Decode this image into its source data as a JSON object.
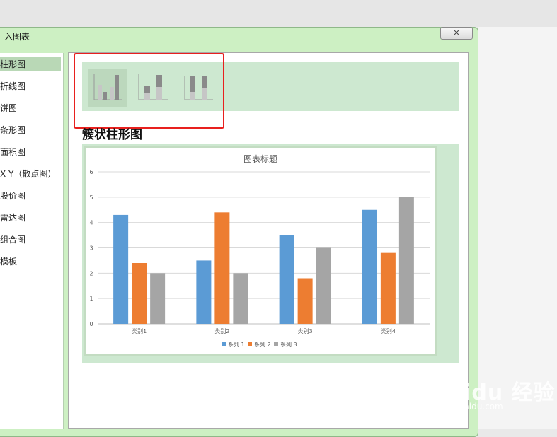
{
  "dialog": {
    "title": "入图表",
    "close_glyph": "✕"
  },
  "nav": {
    "items": [
      {
        "label": "柱形图",
        "selected": true
      },
      {
        "label": "折线图"
      },
      {
        "label": "饼图"
      },
      {
        "label": "条形图"
      },
      {
        "label": "面积图"
      },
      {
        "label": "X Y（散点图）"
      },
      {
        "label": "股价图"
      },
      {
        "label": "雷达图"
      },
      {
        "label": "组合图"
      },
      {
        "label": "模板"
      }
    ]
  },
  "subtypes": [
    {
      "name": "clustered-column-icon",
      "selected": true
    },
    {
      "name": "stacked-column-icon"
    },
    {
      "name": "percent-stacked-column-icon"
    }
  ],
  "selected_chart_name": "簇状柱形图",
  "colors": {
    "accent_red": "#e8201e",
    "series1": "#5b9bd5",
    "series2": "#ed7d31",
    "series3": "#a5a5a5"
  },
  "chart_data": {
    "type": "bar",
    "title": "图表标题",
    "categories": [
      "类别1",
      "类别2",
      "类别3",
      "类别4"
    ],
    "series": [
      {
        "name": "系列 1",
        "values": [
          4.3,
          2.5,
          3.5,
          4.5
        ]
      },
      {
        "name": "系列 2",
        "values": [
          2.4,
          4.4,
          1.8,
          2.8
        ]
      },
      {
        "name": "系列 3",
        "values": [
          2,
          2,
          3,
          5
        ]
      }
    ],
    "ylim": [
      0,
      6
    ],
    "yticks": [
      "0",
      "1",
      "2",
      "3",
      "4",
      "5",
      "6"
    ],
    "grid": true,
    "legend": "bottom"
  },
  "watermark": {
    "brand": "Baidu 经验",
    "url": "jingyan.baidu.com"
  }
}
